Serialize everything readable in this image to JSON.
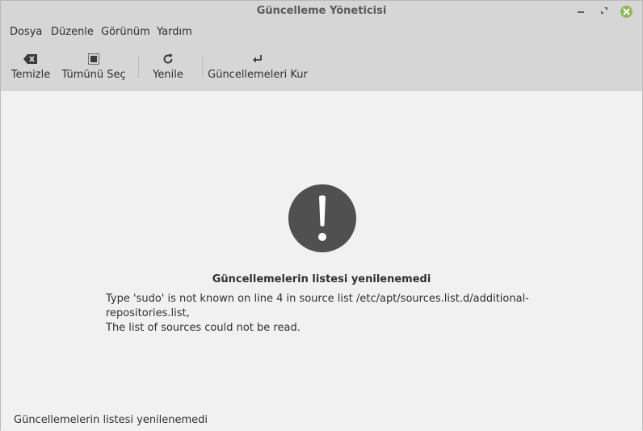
{
  "window": {
    "title": "Güncelleme Yöneticisi",
    "controls": {
      "minimize": "minimize-icon",
      "maximize": "maximize-icon",
      "close": "close-icon"
    },
    "accent_close": "#8fb758"
  },
  "menu": {
    "items": [
      "Dosya",
      "Düzenle",
      "Görünüm",
      "Yardım"
    ]
  },
  "toolbar": {
    "clear_label": "Temizle",
    "select_all_label": "Tümünü Seç",
    "refresh_label": "Yenile",
    "install_label": "Güncellemeleri Kur"
  },
  "error": {
    "icon": "exclamation-circle-icon",
    "icon_color": "#505050",
    "title": "Güncellemelerin listesi yenilenemedi",
    "message_line1": "Type 'sudo' is not known on line 4 in source list /etc/apt/sources.list.d/additional-repositories.list,",
    "message_line2": "The list of sources could not be read."
  },
  "status": {
    "text": "Güncellemelerin listesi yenilenemedi"
  }
}
